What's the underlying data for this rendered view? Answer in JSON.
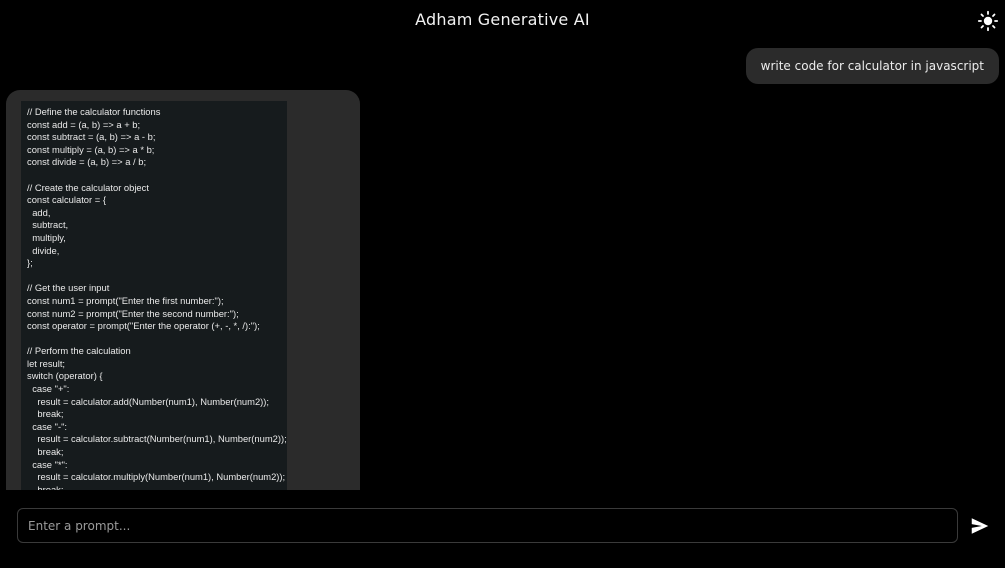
{
  "header": {
    "title": "Adham Generative AI",
    "theme_icon": "sun-icon"
  },
  "messages": {
    "user": "write code for calculator in javascript",
    "bot_code": "// Define the calculator functions\nconst add = (a, b) => a + b;\nconst subtract = (a, b) => a - b;\nconst multiply = (a, b) => a * b;\nconst divide = (a, b) => a / b;\n\n// Create the calculator object\nconst calculator = {\n  add,\n  subtract,\n  multiply,\n  divide,\n};\n\n// Get the user input\nconst num1 = prompt(\"Enter the first number:\");\nconst num2 = prompt(\"Enter the second number:\");\nconst operator = prompt(\"Enter the operator (+, -, *, /):\");\n\n// Perform the calculation\nlet result;\nswitch (operator) {\n  case \"+\":\n    result = calculator.add(Number(num1), Number(num2));\n    break;\n  case \"-\":\n    result = calculator.subtract(Number(num1), Number(num2));\n    break;\n  case \"*\":\n    result = calculator.multiply(Number(num1), Number(num2));\n    break;"
  },
  "prompt": {
    "placeholder": "Enter a prompt...",
    "value": "",
    "send_icon": "send-icon"
  },
  "colors": {
    "background": "#000000",
    "bubble": "#2b2b2b",
    "code_background": "#161b1d",
    "text": "#e8e8e8"
  }
}
